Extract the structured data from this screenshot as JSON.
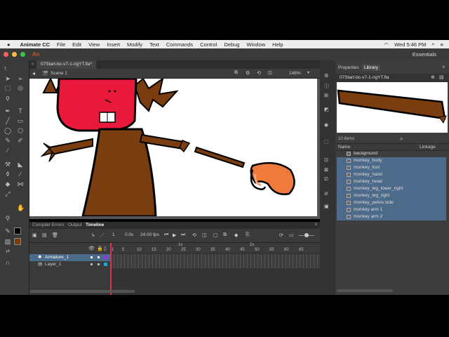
{
  "menubar": {
    "app": "Animate CC",
    "items": [
      "File",
      "Edit",
      "View",
      "Insert",
      "Modify",
      "Text",
      "Commands",
      "Control",
      "Debug",
      "Window",
      "Help"
    ],
    "clock": "Wed 5:46 PM"
  },
  "titlebar": {
    "an": "An",
    "workspace": "Essentials"
  },
  "document": {
    "tab": "07Start-bc-v7-1-rigYT.fla*",
    "scene": "Scene 1",
    "zoom": "148%"
  },
  "timeline": {
    "tabs": [
      "Compiler Errors",
      "Output",
      "Timeline"
    ],
    "current_frame": "1",
    "time": "0.0s",
    "fps": "24.00 fps",
    "time_markers": [
      "1s",
      "2s"
    ],
    "frame_numbers": [
      "1",
      "5",
      "10",
      "15",
      "20",
      "25",
      "30",
      "35",
      "40",
      "45",
      "50",
      "55",
      "60",
      "65"
    ],
    "layers": [
      {
        "name": "Armature_1"
      },
      {
        "name": "Layer_1"
      }
    ]
  },
  "panel": {
    "tabs": [
      "Properties",
      "Library"
    ],
    "file": "07Start-bc-v7-1-rigYT.fla",
    "items_count": "10 Items",
    "columns": [
      "Name",
      "Linkage"
    ],
    "items": [
      "background",
      "monkey_body",
      "monkey_foot",
      "monkey_hand",
      "monkey_head",
      "monkey_leg_lower_right",
      "monkey_leg_right",
      "monkey_pelvis side",
      "monkey arm 1",
      "monkey arm 2"
    ]
  },
  "colors": {
    "selection": "#4c6a8a",
    "monkey_brown": "#7a3d10",
    "face": "#e8193a",
    "hand_orange": "#f07a3c"
  }
}
